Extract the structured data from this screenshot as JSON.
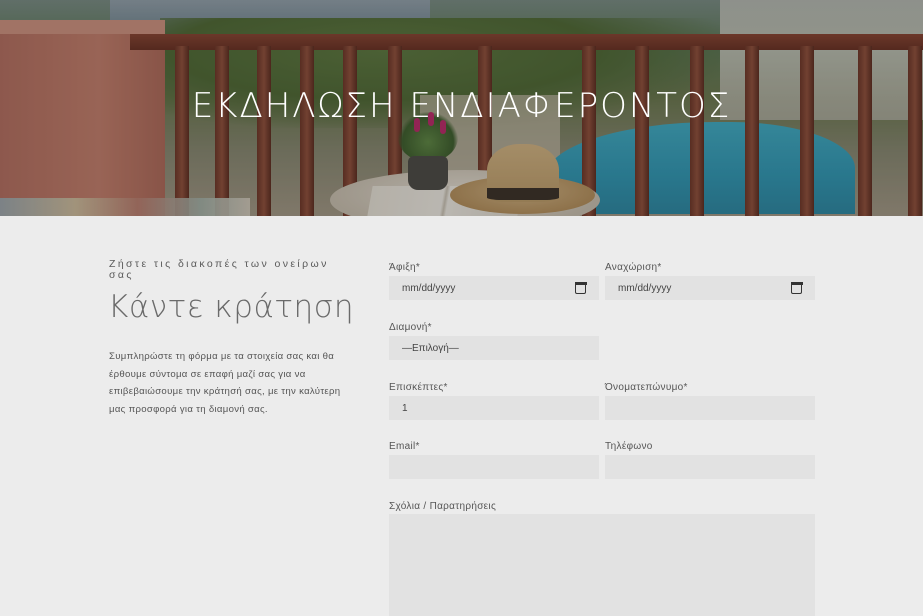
{
  "hero": {
    "title": "ΕΚΔΗΛΩΣΗ ΕΝΔΙΑΦΕΡΟΝΤΟΣ"
  },
  "intro": {
    "kicker": "Ζήστε τις διακοπές των ονείρων σας",
    "title": "Κάντε κράτηση",
    "text": "Συμπληρώστε τη φόρμα με τα στοιχεία σας και θα έρθουμε σύντομα σε επαφή μαζί σας για να επιβεβαιώσουμε την κράτησή σας, με την καλύτερη μας προσφορά για τη διαμονή σας."
  },
  "form": {
    "arrival": {
      "label": "Άφιξη*",
      "placeholder": "mm/dd/yyyy",
      "icon": "calendar-icon"
    },
    "departure": {
      "label": "Αναχώριση*",
      "placeholder": "mm/dd/yyyy",
      "icon": "calendar-icon"
    },
    "stay": {
      "label": "Διαμονή*",
      "value": "—Επιλογή—"
    },
    "guests": {
      "label": "Επισκέπτες*",
      "value": "1"
    },
    "fullname": {
      "label": "Όνοματεπώνυμο*",
      "value": ""
    },
    "email": {
      "label": "Email*",
      "value": ""
    },
    "phone": {
      "label": "Τηλέφωνο",
      "value": ""
    },
    "comments": {
      "label": "Σχόλια / Παρατηρήσεις",
      "value": ""
    }
  },
  "colors": {
    "page_background": "#ececec",
    "field_background": "#e2e2e2",
    "text": "#555555"
  }
}
